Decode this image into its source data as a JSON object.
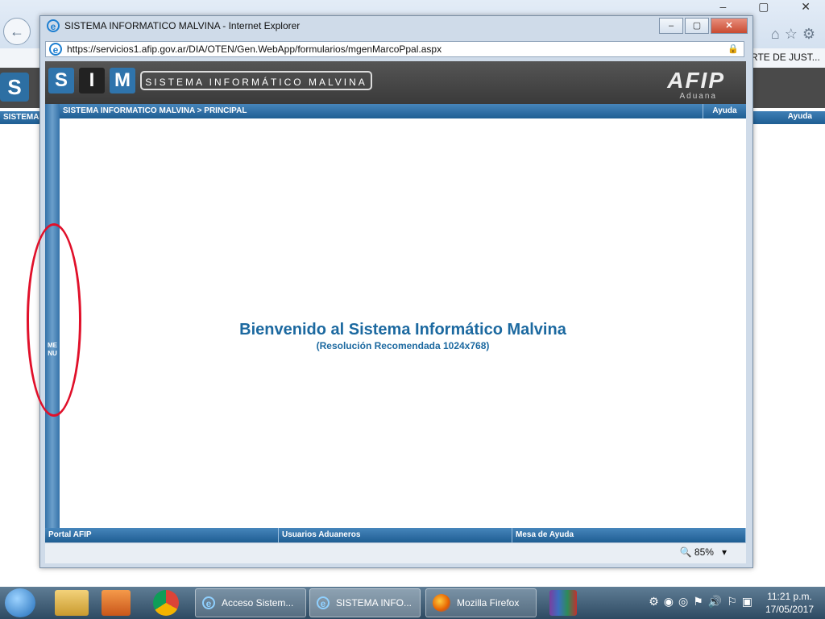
{
  "background_browser": {
    "favorites_text": "RTE DE JUST...",
    "breadcrumb": "SISTEMA I",
    "help": "Ayuda",
    "logo_letter": "S"
  },
  "popup": {
    "window_title": "SISTEMA INFORMATICO MALVINA - Internet Explorer",
    "url": "https://servicios1.afip.gov.ar/DIA/OTEN/Gen.WebApp/formularios/mgenMarcoPpal.aspx",
    "header": {
      "letters": [
        "S",
        "I",
        "M"
      ],
      "system_title": "SISTEMA INFORMÁTICO MALVINA",
      "org_logo": "AFIP",
      "org_sub": "Aduana"
    },
    "breadcrumb": "SISTEMA INFORMATICO MALVINA > PRINCIPAL",
    "help_link": "Ayuda",
    "menu_label": "MENU",
    "welcome": "Bienvenido al Sistema Informático Malvina",
    "resolution_note": "(Resolución Recomendada 1024x768)",
    "footer_links": [
      "Portal AFIP",
      "Usuarios Aduaneros",
      "Mesa de Ayuda"
    ],
    "zoom": "85%",
    "highlight_color": "#e0102a",
    "brand_color": "#1c69a0"
  },
  "taskbar": {
    "tasks": [
      {
        "label": "Acceso Sistem..."
      },
      {
        "label": "SISTEMA INFO..."
      },
      {
        "label": "Mozilla Firefox"
      }
    ],
    "time": "11:21 p.m.",
    "date": "17/05/2017"
  }
}
